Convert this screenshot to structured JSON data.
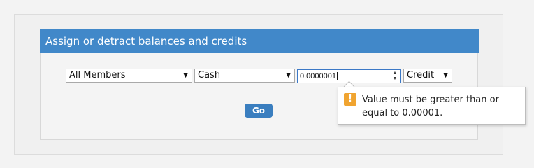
{
  "panel": {
    "title": "Assign or detract balances and credits"
  },
  "form": {
    "member_select": {
      "selected": "All Members"
    },
    "currency_select": {
      "selected": "Cash"
    },
    "amount_input": {
      "value": "0.0000001"
    },
    "type_select": {
      "selected": "Credit"
    },
    "go_label": "Go"
  },
  "validation": {
    "icon": "warning-icon",
    "message": "Value must be greater than or equal to 0.00001."
  },
  "colors": {
    "header_bg": "#4188c9",
    "button_bg": "#3a7ebf",
    "warning": "#f0a430"
  }
}
